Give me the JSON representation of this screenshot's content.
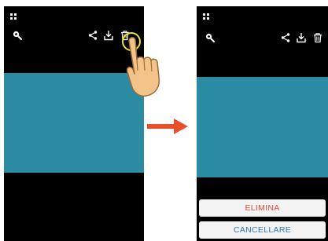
{
  "screens": {
    "before": {
      "toolbar_icons": [
        "menu-icon",
        "camera-switch-icon",
        "share-icon",
        "download-icon",
        "trash-icon"
      ],
      "photo_color": "#2b8ba3"
    },
    "after": {
      "toolbar_icons": [
        "menu-icon",
        "camera-switch-icon",
        "share-icon",
        "download-icon",
        "trash-icon"
      ],
      "photo_color": "#2b8ba3",
      "action_sheet": {
        "delete_label": "ELIMINA",
        "cancel_label": "CANCELLARE"
      }
    }
  },
  "annotation": {
    "arrow_color": "#e8502c",
    "highlight_color": "#f1e42b",
    "pointer": "tapping-hand-icon"
  },
  "colors": {
    "delete_text": "#e3473b",
    "cancel_text": "#2c79b6",
    "background": "#000000"
  }
}
